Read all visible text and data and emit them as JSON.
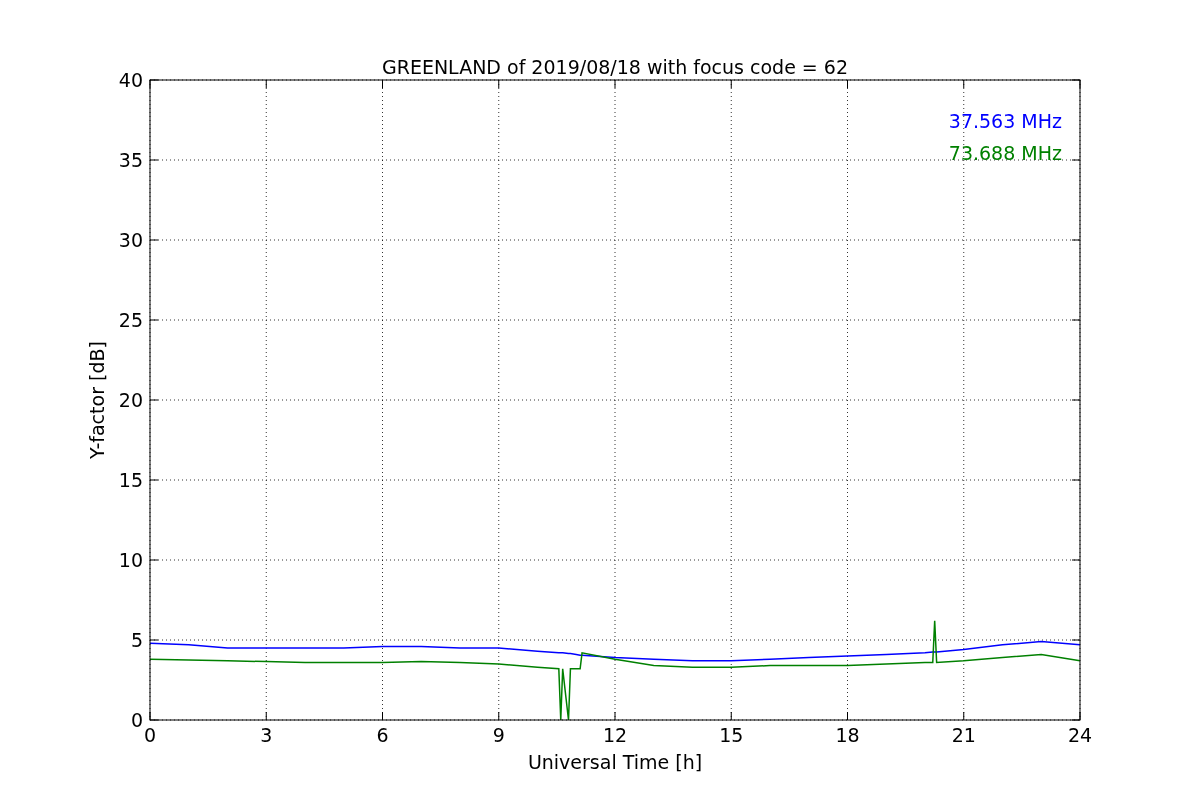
{
  "chart_data": {
    "type": "line",
    "title": "GREENLAND of 2019/08/18 with focus code = 62",
    "xlabel": "Universal Time [h]",
    "ylabel": "Y-factor [dB]",
    "x": [
      0,
      1,
      2,
      3,
      4,
      5,
      6,
      7,
      8,
      9,
      10,
      10.55,
      10.6,
      10.65,
      10.8,
      10.85,
      11,
      11.1,
      11.15,
      12,
      13,
      14,
      15,
      16,
      17,
      18,
      19,
      20,
      20.2,
      20.25,
      20.3,
      21,
      22,
      23,
      24
    ],
    "series": [
      {
        "name": "37.563 MHz",
        "color": "#0000ff",
        "values": [
          4.8,
          4.7,
          4.5,
          4.5,
          4.5,
          4.5,
          4.6,
          4.6,
          4.5,
          4.5,
          4.3,
          4.2,
          4.2,
          4.2,
          4.15,
          4.15,
          4.1,
          4.05,
          4.05,
          3.9,
          3.8,
          3.7,
          3.7,
          3.8,
          3.9,
          4.0,
          4.1,
          4.2,
          4.25,
          4.25,
          4.25,
          4.4,
          4.7,
          4.9,
          4.7
        ]
      },
      {
        "name": "73.688 MHz",
        "color": "#008000",
        "values": [
          3.8,
          3.75,
          3.7,
          3.65,
          3.6,
          3.6,
          3.6,
          3.65,
          3.6,
          3.5,
          3.3,
          3.2,
          0,
          3.2,
          0,
          3.2,
          3.2,
          3.2,
          4.2,
          3.8,
          3.4,
          3.3,
          3.3,
          3.4,
          3.4,
          3.4,
          3.5,
          3.6,
          3.6,
          6.2,
          3.6,
          3.7,
          3.9,
          4.1,
          3.7
        ]
      }
    ],
    "xlim": [
      0,
      24
    ],
    "ylim": [
      0,
      40
    ],
    "xticks": [
      0,
      3,
      6,
      9,
      12,
      15,
      18,
      21,
      24
    ],
    "yticks": [
      0,
      5,
      10,
      15,
      20,
      25,
      30,
      35,
      40
    ],
    "grid": true
  }
}
